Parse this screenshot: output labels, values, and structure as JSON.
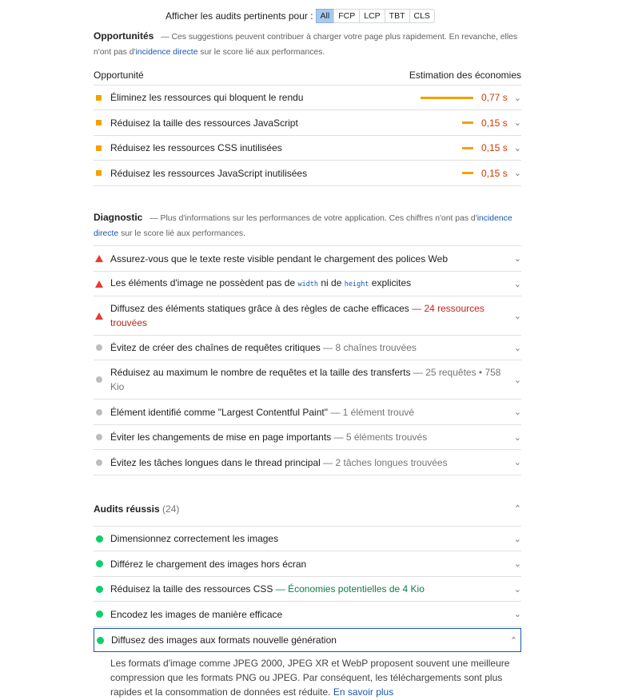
{
  "filter": {
    "label": "Afficher les audits pertinents pour :",
    "buttons": [
      "All",
      "FCP",
      "LCP",
      "TBT",
      "CLS"
    ]
  },
  "opportunities": {
    "title": "Opportunités",
    "desc_prefix": "— Ces suggestions peuvent contribuer à charger votre page plus rapidement. En revanche, elles n'ont pas d'",
    "desc_link": "incidence directe",
    "desc_suffix": " sur le score lié aux performances.",
    "col_left": "Opportunité",
    "col_right": "Estimation des économies",
    "items": [
      {
        "label": "Éliminez les ressources qui bloquent le rendu",
        "savings": "0,77 s",
        "savings_seconds": 0.77
      },
      {
        "label": "Réduisez la taille des ressources JavaScript",
        "savings": "0,15 s",
        "savings_seconds": 0.15
      },
      {
        "label": "Réduisez les ressources CSS inutilisées",
        "savings": "0,15 s",
        "savings_seconds": 0.15
      },
      {
        "label": "Réduisez les ressources JavaScript inutilisées",
        "savings": "0,15 s",
        "savings_seconds": 0.15
      }
    ]
  },
  "diagnostic": {
    "title": "Diagnostic",
    "desc_prefix": "— Plus d'informations sur les performances de votre application. Ces chiffres n'ont pas d'",
    "desc_link": "incidence directe",
    "desc_suffix": " sur le score lié aux performances.",
    "items": [
      {
        "label": "Assurez-vous que le texte reste visible pendant le chargement des polices Web",
        "detail": ""
      },
      {
        "label_a": "Les éléments d'image ne possèdent pas de ",
        "code_a": "width",
        "label_b": " ni de ",
        "code_b": "height",
        "label_c": " explicites"
      },
      {
        "label": "Diffusez des éléments statiques grâce à des règles de cache efficaces",
        "detail": "— 24 ressources trouvées"
      },
      {
        "label": "Évitez de créer des chaînes de requêtes critiques",
        "detail": "— 8 chaînes trouvées"
      },
      {
        "label": "Réduisez au maximum le nombre de requêtes et la taille des transferts",
        "detail": "— 25 requêtes • 758 Kio"
      },
      {
        "label": "Élément identifié comme \"Largest Contentful Paint\"",
        "detail": "— 1 élément trouvé"
      },
      {
        "label": "Éviter les changements de mise en page importants",
        "detail": "— 5 éléments trouvés"
      },
      {
        "label": "Évitez les tâches longues dans le thread principal",
        "detail": "— 2 tâches longues trouvées"
      }
    ]
  },
  "passed": {
    "title": "Audits réussis",
    "count": "(24)",
    "items": [
      {
        "label": "Dimensionnez correctement les images",
        "detail": ""
      },
      {
        "label": "Différez le chargement des images hors écran",
        "detail": ""
      },
      {
        "label": "Réduisez la taille des ressources CSS",
        "detail": "— Économies potentielles de 4 Kio"
      },
      {
        "label": "Encodez les images de manière efficace",
        "detail": ""
      },
      {
        "label": "Diffusez des images aux formats nouvelle génération",
        "detail": ""
      }
    ],
    "expanded_text": "Les formats d'image comme JPEG 2000, JPEG XR et WebP proposent souvent une meilleure compression que les formats PNG ou JPEG. Par conséquent, les téléchargements sont plus rapides et la consommation de données est réduite. ",
    "expanded_link": "En savoir plus"
  },
  "colors": {
    "average": "#f4a100",
    "fail": "#eb3a32",
    "pass": "#0cce6b",
    "link": "#1a56ae"
  }
}
